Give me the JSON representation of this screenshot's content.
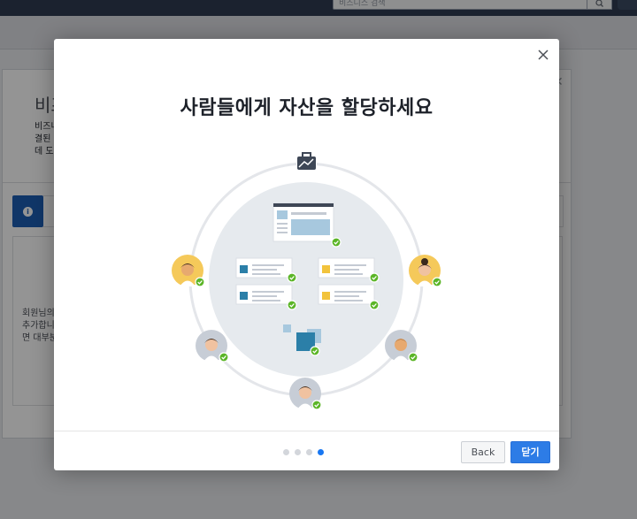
{
  "background": {
    "search_placeholder": "비즈니스 검색",
    "title": "비즈",
    "description": "비즈니\n결된\n데 도",
    "panel_text": "회원님의\n추가합니\n면 대부분"
  },
  "modal": {
    "title": "사람들에게 자산을 할당하세요",
    "close_icon": "close-icon",
    "pagination": {
      "total": 4,
      "current": 4
    },
    "buttons": {
      "back_label": "Back",
      "close_label": "닫기"
    }
  },
  "colors": {
    "primary": "#2d7ce6",
    "check": "#5bb527",
    "asset_blue": "#2b7fa8",
    "asset_yellow": "#f2c33c",
    "avatar_yellow": "#f5c95a",
    "avatar_gray": "#c7cdd6",
    "topbar": "#2f3b52"
  },
  "icons": [
    "search-icon",
    "close-icon",
    "info-icon",
    "briefcase-icon",
    "check-icon",
    "person-avatar-icon",
    "page-asset-icon"
  ]
}
